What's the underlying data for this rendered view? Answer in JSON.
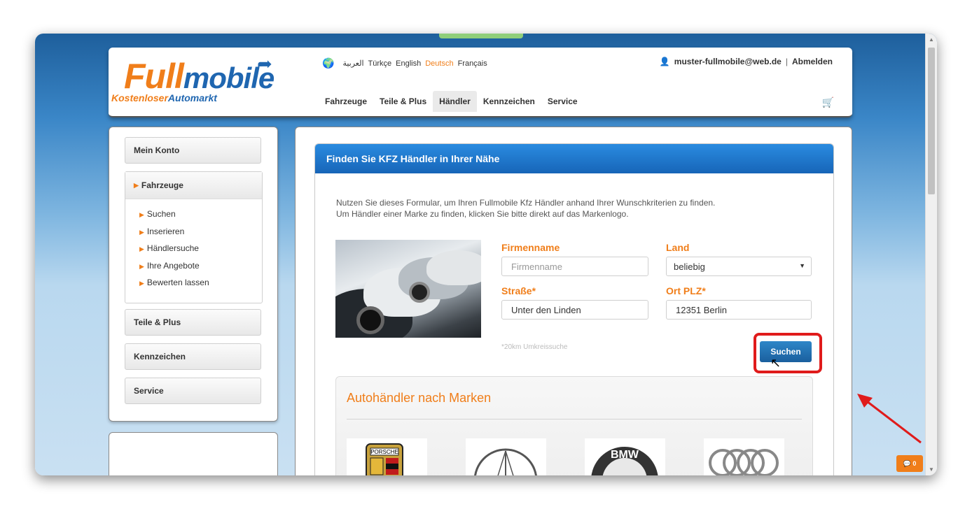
{
  "header": {
    "logo": {
      "brand_full": "Full",
      "brand_mobile": "mobile",
      "tagline_part1": "Kostenloser",
      "tagline_part2": "Automarkt"
    },
    "languages": [
      {
        "label": "العربية",
        "active": false
      },
      {
        "label": "Türkçe",
        "active": false
      },
      {
        "label": "English",
        "active": false
      },
      {
        "label": "Deutsch",
        "active": true
      },
      {
        "label": "Français",
        "active": false
      }
    ],
    "user_email": "muster-fullmobile@web.de",
    "separator": "|",
    "logout": "Abmelden",
    "nav": [
      "Fahrzeuge",
      "Teile & Plus",
      "Händler",
      "Kennzeichen",
      "Service"
    ],
    "nav_active": "Händler",
    "icons": {
      "globe": "globe-icon",
      "user": "user-icon",
      "cart": "cart-icon"
    }
  },
  "sidebar": {
    "account": "Mein Konto",
    "vehicles": "Fahrzeuge",
    "vehicle_items": [
      "Suchen",
      "Inserieren",
      "Händlersuche",
      "Ihre Angebote",
      "Bewerten lassen"
    ],
    "parts": "Teile & Plus",
    "plates": "Kennzeichen",
    "service": "Service"
  },
  "panel": {
    "title": "Finden Sie KFZ Händler in Ihrer Nähe",
    "intro_line1": "Nutzen Sie dieses Formular, um Ihren Fullmobile Kfz Händler anhand Ihrer Wunschkriterien zu finden.",
    "intro_line2": "Um Händler einer Marke zu finden, klicken Sie bitte direkt auf das Markenlogo.",
    "form": {
      "company_label": "Firmenname",
      "company_placeholder": "Firmenname",
      "country_label": "Land",
      "country_value": "beliebig",
      "street_label": "Straße*",
      "street_value": "Unter den Linden",
      "city_label": "Ort PLZ*",
      "city_value": "12351 Berlin",
      "radius_note": "*20km Umkreissuche",
      "search_button": "Suchen"
    },
    "brands_title": "Autohändler nach Marken",
    "brands": [
      "porsche-logo",
      "mercedes-logo",
      "bmw-logo",
      "audi-logo"
    ],
    "bmw_letters": "BMW",
    "porsche_text": "PORSCHE"
  },
  "chat": {
    "count": "0"
  },
  "colors": {
    "accent": "#f07e1a",
    "blue": "#1f66b0",
    "highlight": "#e01b1b"
  }
}
